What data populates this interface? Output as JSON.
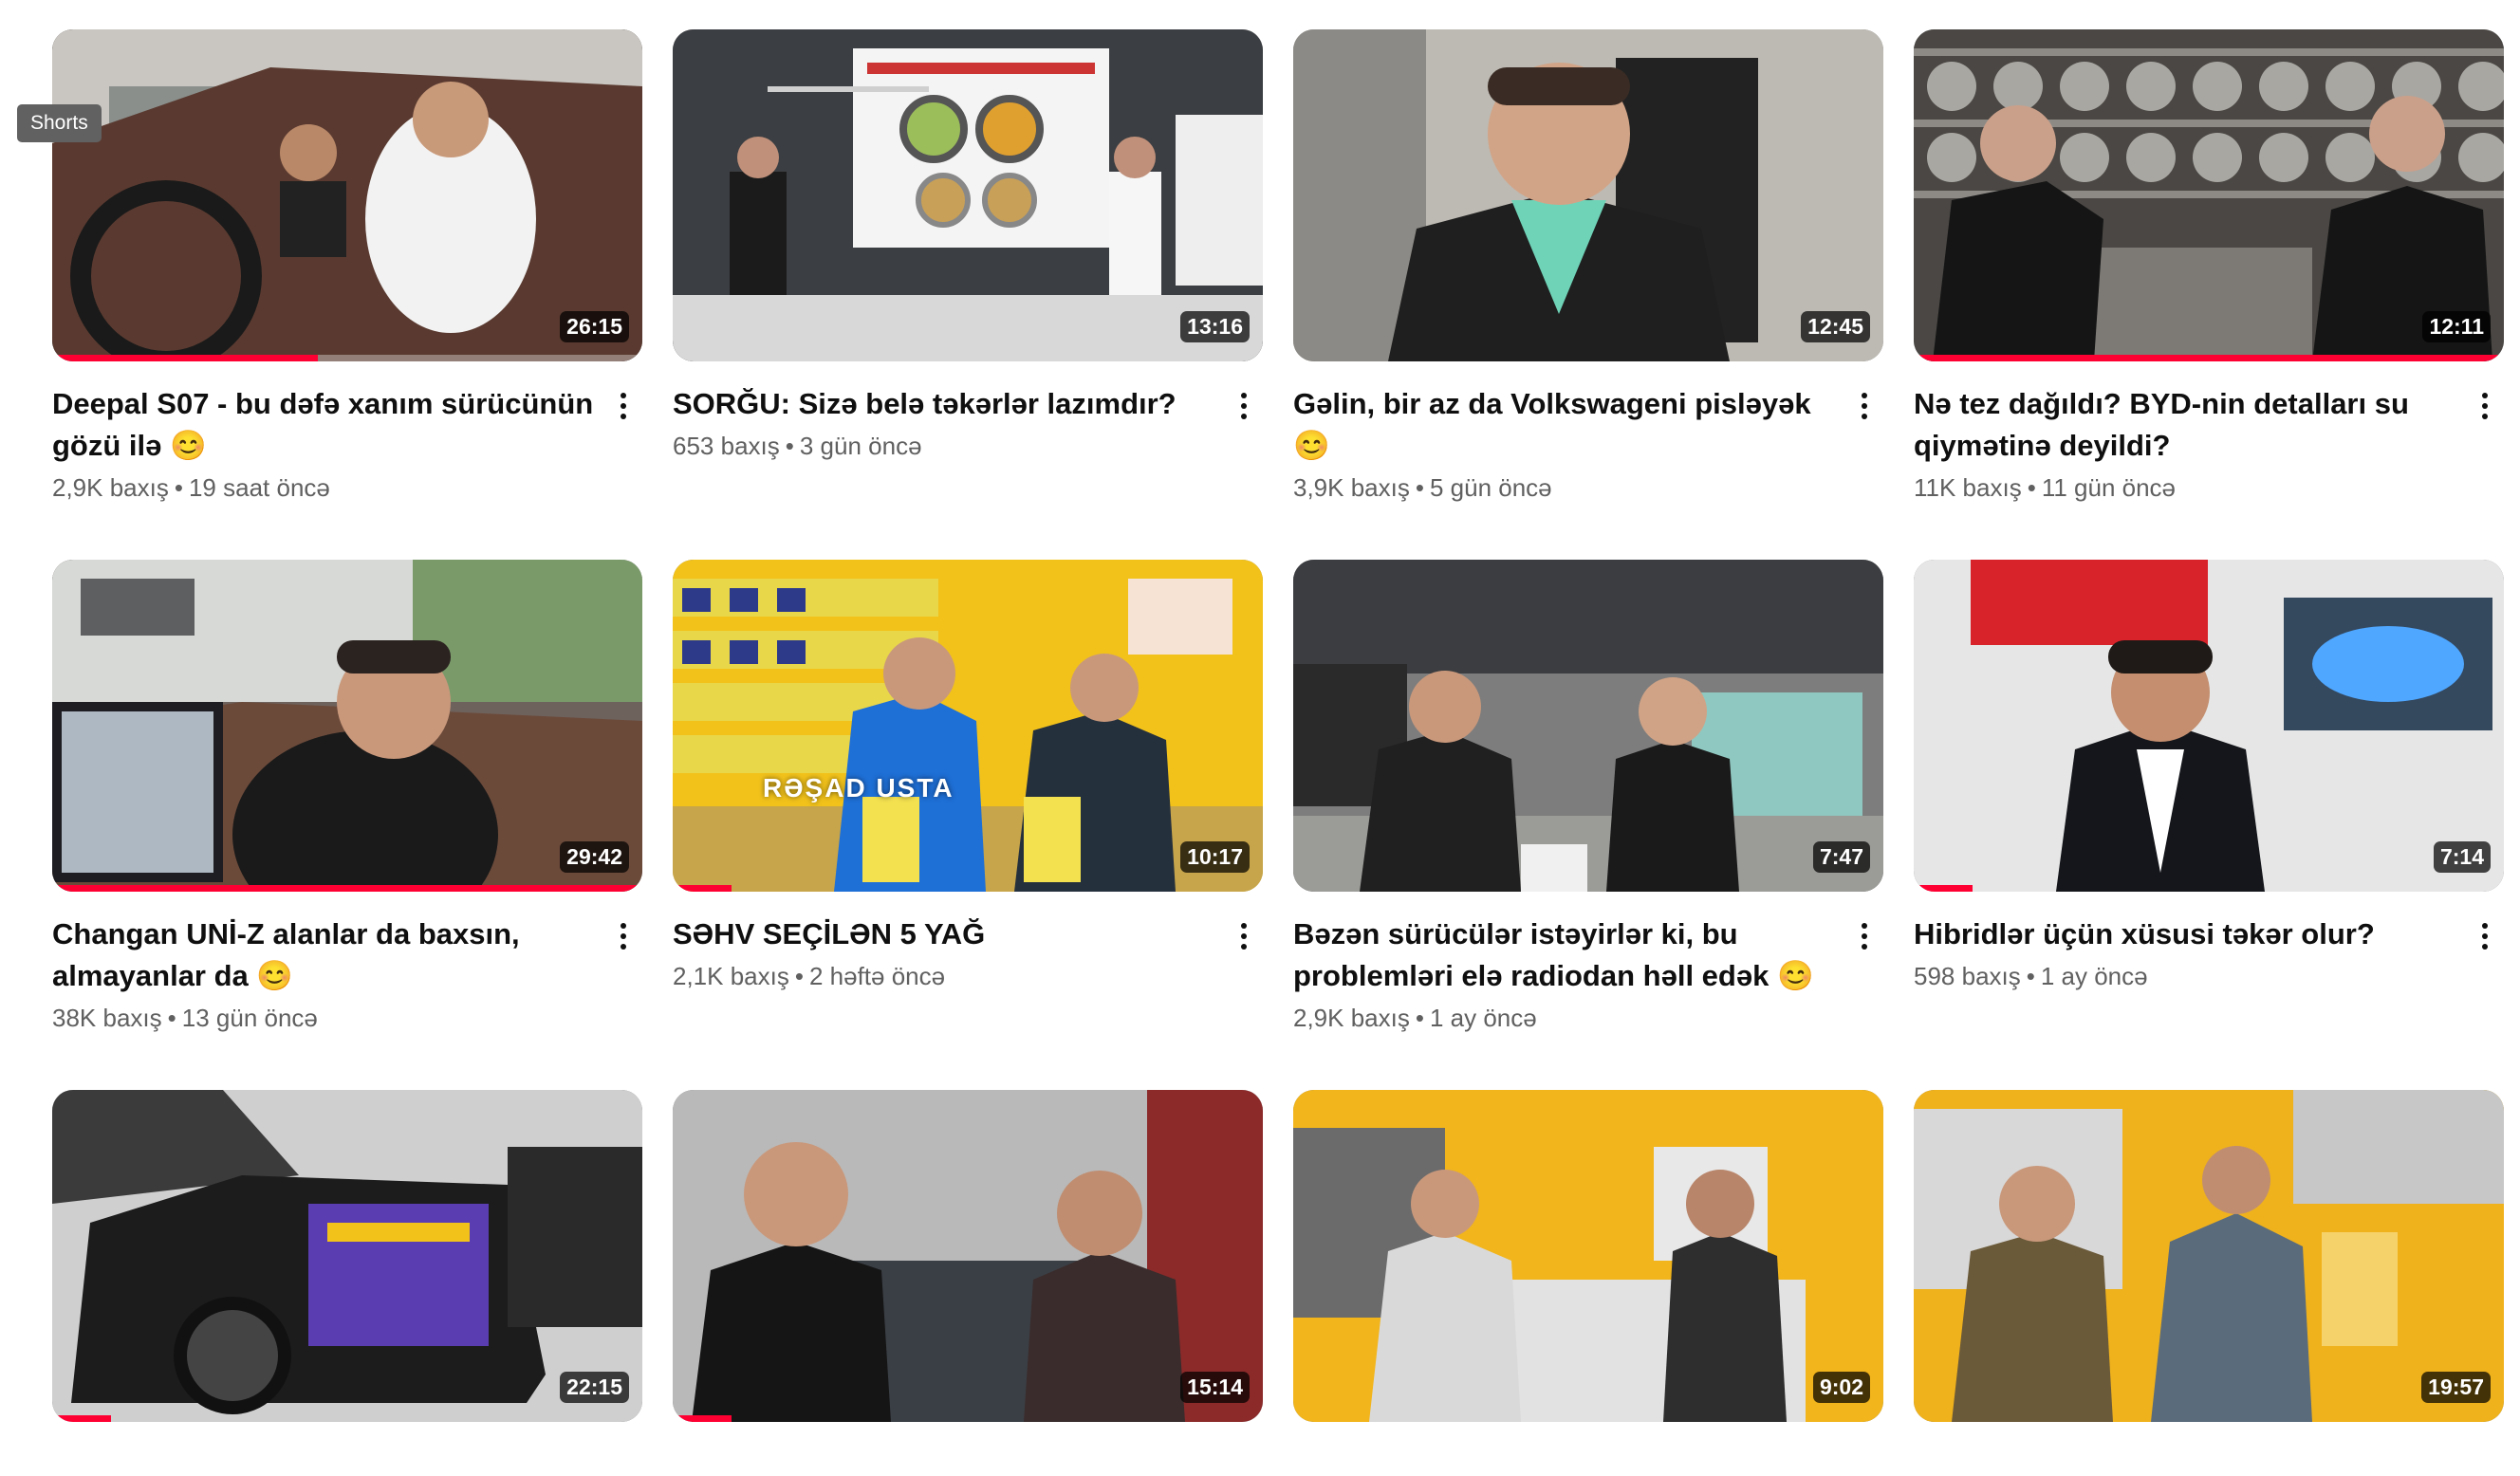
{
  "tooltip": "Shorts",
  "videos": [
    {
      "title": "Deepal S07 - bu dəfə xanım sürücünün gözü ilə 😊",
      "views": "2,9K baxış",
      "age": "19 saat öncə",
      "duration": "26:15",
      "progress": 0.45
    },
    {
      "title": "SORĞU: Sizə belə təkərlər lazımdır?",
      "views": "653 baxış",
      "age": "3 gün öncə",
      "duration": "13:16",
      "progress": 0.0
    },
    {
      "title": "Gəlin, bir az da Volkswageni pisləyək 😊",
      "views": "3,9K baxış",
      "age": "5 gün öncə",
      "duration": "12:45",
      "progress": 0.0
    },
    {
      "title": "Nə tez dağıldı? BYD-nin detalları su qiymətinə deyildi?",
      "views": "11K baxış",
      "age": "11 gün öncə",
      "duration": "12:11",
      "progress": 1.0
    },
    {
      "title": "Changan UNİ-Z alanlar da baxsın, almayanlar da 😊",
      "views": "38K baxış",
      "age": "13 gün öncə",
      "duration": "29:42",
      "progress": 1.0
    },
    {
      "title": "SƏHV SEÇİLƏN 5 YAĞ",
      "views": "2,1K baxış",
      "age": "2 həftə öncə",
      "duration": "10:17",
      "progress": 0.1,
      "overlay": "RƏŞAD USTA"
    },
    {
      "title": "Bəzən sürücülər istəyirlər ki, bu problemləri elə radiodan həll edək 😊",
      "views": "2,9K baxış",
      "age": "1 ay öncə",
      "duration": "7:47",
      "progress": 0.0
    },
    {
      "title": "Hibridlər üçün xüsusi təkər olur?",
      "views": "598 baxış",
      "age": "1 ay öncə",
      "duration": "7:14",
      "progress": 0.1
    },
    {
      "title": "",
      "views": "",
      "age": "",
      "duration": "22:15",
      "progress": 0.1
    },
    {
      "title": "",
      "views": "",
      "age": "",
      "duration": "15:14",
      "progress": 0.1
    },
    {
      "title": "",
      "views": "",
      "age": "",
      "duration": "9:02",
      "progress": 0.0
    },
    {
      "title": "",
      "views": "",
      "age": "",
      "duration": "19:57",
      "progress": 0.0
    }
  ]
}
